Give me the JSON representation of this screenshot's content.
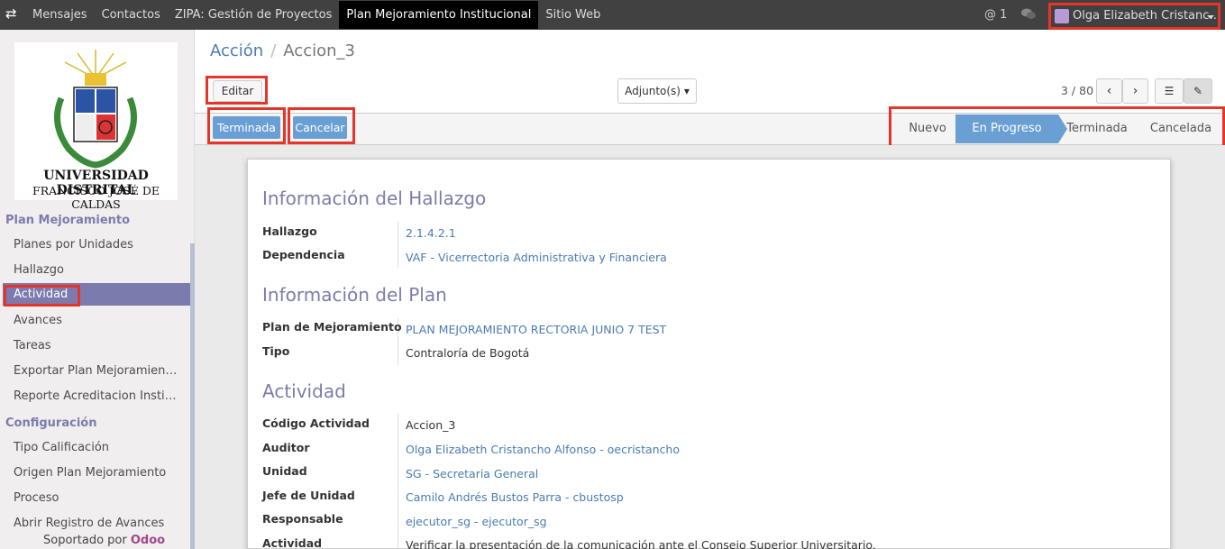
{
  "topbar": {
    "apps": [
      "Mensajes",
      "Contactos",
      "ZIPA: Gestión de Proyectos",
      "Plan Mejoramiento Institucional",
      "Sitio Web"
    ],
    "mentions": "@ 1",
    "user": "Olga Elizabeth Cristanc…"
  },
  "sidebar": {
    "logo_line1": "UNIVERSIDAD DISTRITAL",
    "logo_line2": "FRANCISCO JOSÉ DE CALDAS",
    "section1": "Plan Mejoramiento",
    "items1": [
      "Planes por Unidades",
      "Hallazgo",
      "Actividad",
      "Avances",
      "Tareas",
      "Exportar Plan Mejoramien…",
      "Reporte Acreditacion Insti…"
    ],
    "section2": "Configuración",
    "items2": [
      "Tipo Calificación",
      "Origen Plan Mejoramiento",
      "Proceso",
      "Abrir Registro de Avances"
    ],
    "powered": "Soportado por",
    "powered_brand": "Odoo"
  },
  "breadcrumb": {
    "parent": "Acción",
    "current": "Accion_3"
  },
  "toolbar": {
    "edit": "Editar",
    "attach": "Adjunto(s)",
    "pager": "3 / 80"
  },
  "actions": {
    "done": "Terminada",
    "cancel": "Cancelar"
  },
  "stages": {
    "s1": "Nuevo",
    "s2": "En Progreso",
    "s3": "Terminada",
    "s4": "Cancelada"
  },
  "form": {
    "sec1": "Información del Hallazgo",
    "hallazgo_label": "Hallazgo",
    "hallazgo": "2.1.4.2.1",
    "dependencia_label": "Dependencia",
    "dependencia": "VAF - Vicerrectoria Administrativa y Financiera",
    "sec2": "Información del Plan",
    "plan_label": "Plan de Mejoramiento",
    "plan": "PLAN MEJORAMIENTO RECTORIA JUNIO 7 TEST",
    "tipo_label": "Tipo",
    "tipo": "Contraloría de Bogotá",
    "sec3": "Actividad",
    "codigo_label": "Código Actividad",
    "codigo": "Accion_3",
    "auditor_label": "Auditor",
    "auditor": "Olga Elizabeth Cristancho Alfonso - oecristancho",
    "unidad_label": "Unidad",
    "unidad": "SG - Secretaria General",
    "jefe_label": "Jefe de Unidad",
    "jefe": "Camilo Andrés Bustos Parra - cbustosp",
    "resp_label": "Responsable",
    "resp": "ejecutor_sg - ejecutor_sg",
    "act_label": "Actividad",
    "act": "Verificar la presentación de la comunicación ante el Consejo Superior Universitario."
  }
}
